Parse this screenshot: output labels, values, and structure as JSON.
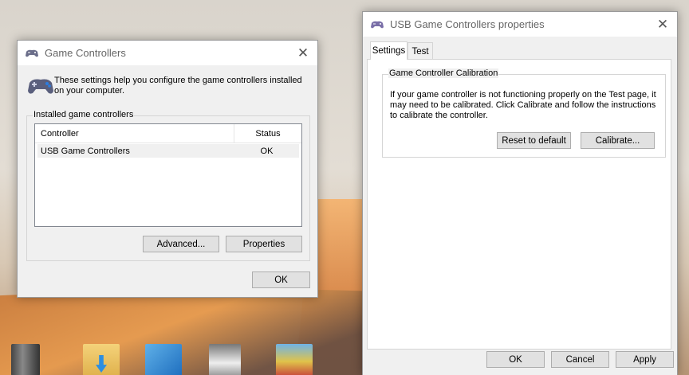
{
  "game_controllers": {
    "title": "Game Controllers",
    "intro": "These settings help you configure the game controllers installed on your computer.",
    "group_label": "Installed game controllers",
    "columns": [
      "Controller",
      "Status"
    ],
    "rows": [
      {
        "controller": "USB Game Controllers",
        "status": "OK"
      }
    ],
    "advanced_label": "Advanced...",
    "properties_label": "Properties",
    "ok_label": "OK"
  },
  "properties": {
    "title": "USB Game Controllers properties",
    "tabs": [
      "Settings",
      "Test"
    ],
    "active_tab": "Settings",
    "group_label": "Game Controller Calibration",
    "calibration_text": "If your game controller is not functioning properly on the Test page, it may need to be calibrated.  Click Calibrate and follow the instructions to calibrate the controller.",
    "reset_label": "Reset to default",
    "calibrate_label": "Calibrate...",
    "ok_label": "OK",
    "cancel_label": "Cancel",
    "apply_label": "Apply"
  },
  "icons": {
    "window_icon": "gamepad-icon",
    "close": "close-icon"
  }
}
